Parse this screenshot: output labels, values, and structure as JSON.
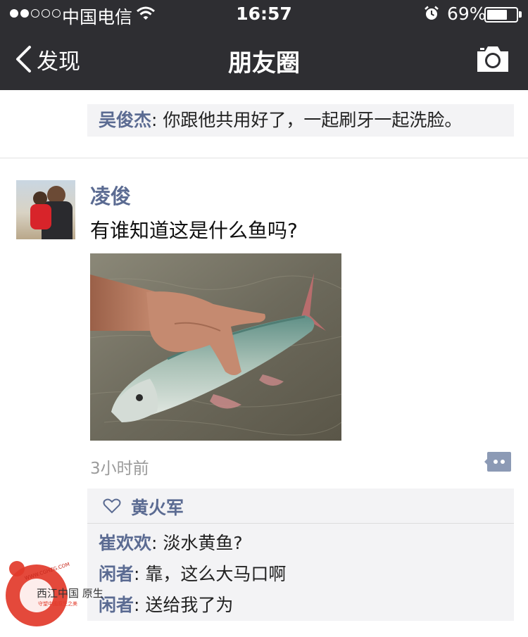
{
  "status_bar": {
    "carrier": "中国电信",
    "time": "16:57",
    "battery_percent": "69%",
    "battery_level": 0.69,
    "signal_strength": 2
  },
  "nav": {
    "back_label": "发现",
    "title": "朋友圈"
  },
  "previous_comment": {
    "author": "吴俊杰",
    "text": ": 你跟他共用好了，一起刷牙一起洗脸。"
  },
  "post": {
    "author": "凌俊",
    "text": "有谁知道这是什么鱼吗?",
    "time_ago": "3小时前",
    "likes": [
      "黄火军"
    ],
    "comments": [
      {
        "author": "崔欢欢",
        "text": ": 淡水黄鱼?"
      },
      {
        "author": "闲者",
        "text": ": 靠，这么大马口啊"
      },
      {
        "author": "闲者",
        "text": ": 送给我了为"
      }
    ]
  },
  "watermark": {
    "text": "西江中国 原生",
    "site": "WWW.CGHZG.COM",
    "slogan": "守望中國原生之美"
  },
  "colors": {
    "nav_bg": "#2e2e32",
    "name_blue": "#5b6b92",
    "comment_bg": "#f3f3f5"
  }
}
